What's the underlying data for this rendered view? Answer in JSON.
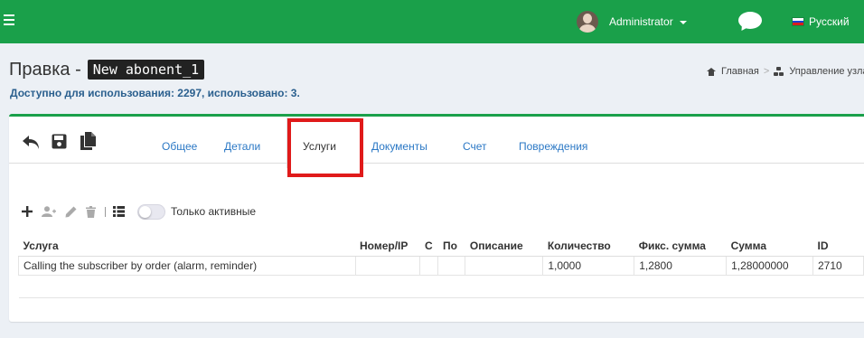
{
  "topbar": {
    "user_name": "Administrator",
    "language": "Русский",
    "colors": {
      "bar": "#1aa04a"
    },
    "icons": [
      "hamburger-icon",
      "avatar",
      "chat-icon",
      "russian-flag-icon"
    ]
  },
  "header": {
    "title_prefix": "Правка -",
    "title_code": "New abonent_1",
    "availability": "Доступно для использования: 2297, использовано: 3."
  },
  "breadcrumbs": [
    {
      "label": "Главная",
      "icon": "home-icon"
    },
    {
      "label": "Управление узлами",
      "icon": "sitemap-icon"
    }
  ],
  "tabs": [
    {
      "label": "Общее",
      "active": false
    },
    {
      "label": "Детали",
      "active": false
    },
    {
      "label": "Услуги",
      "active": true
    },
    {
      "label": "Документы",
      "active": false
    },
    {
      "label": "Счет",
      "active": false
    },
    {
      "label": "Повреждения",
      "active": false
    }
  ],
  "toolbar": {
    "icons": [
      "back-icon",
      "save-icon",
      "copy-icon"
    ],
    "service_tools": [
      "add-icon",
      "add-user-icon",
      "edit-icon",
      "delete-icon",
      "list-icon"
    ],
    "active_toggle_label": "Только активные"
  },
  "table": {
    "columns": [
      "Услуга",
      "Номер/IP",
      "С",
      "По",
      "Описание",
      "Количество",
      "Фикс. сумма",
      "Сумма",
      "ID"
    ],
    "rows": [
      [
        "Calling the subscriber by order (alarm, reminder)",
        "",
        "",
        "",
        "",
        "1,0000",
        "1,2800",
        "1,28000000",
        "2710"
      ]
    ]
  },
  "highlight_color": "#e01a1a"
}
